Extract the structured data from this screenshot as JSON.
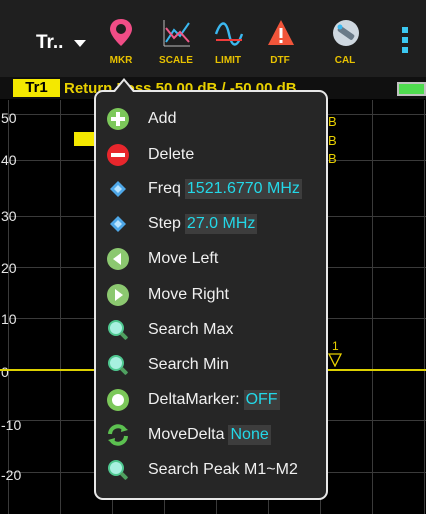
{
  "toolbar": {
    "trace_selector": "Tr..",
    "buttons": [
      {
        "label": "MKR",
        "icon": "marker-pin-icon"
      },
      {
        "label": "SCALE",
        "icon": "scale-icon"
      },
      {
        "label": "LIMIT",
        "icon": "limit-icon"
      },
      {
        "label": "DTF",
        "icon": "dtf-warning-icon"
      },
      {
        "label": "CAL",
        "icon": "cal-icon"
      }
    ],
    "more_icon": "more-vertical-icon"
  },
  "status_strip": {
    "trace_badge": "Tr1",
    "text": "Return Loss 50.00 dB / -50.00 dB"
  },
  "plot": {
    "y_ticks": [
      "50",
      "40",
      "30",
      "20",
      "10",
      "0",
      "-10",
      "-20"
    ],
    "marker_label": "1",
    "behind_menu_fragments": [
      "B",
      "B",
      "B"
    ]
  },
  "menu": {
    "items": [
      {
        "label": "Add",
        "icon": "add-icon"
      },
      {
        "label": "Delete",
        "icon": "delete-icon"
      },
      {
        "label": "Freq",
        "value": "1521.6770 MHz",
        "icon": "diamond-icon"
      },
      {
        "label": "Step",
        "value": "27.0 MHz",
        "icon": "diamond-icon"
      },
      {
        "label": "Move Left",
        "icon": "move-left-icon"
      },
      {
        "label": "Move Right",
        "icon": "move-right-icon"
      },
      {
        "label": "Search Max",
        "icon": "search-max-icon"
      },
      {
        "label": "Search Min",
        "icon": "search-min-icon"
      },
      {
        "label": "DeltaMarker:",
        "value": "OFF",
        "icon": "delta-toggle-icon"
      },
      {
        "label": "MoveDelta",
        "value": "None",
        "icon": "move-delta-icon"
      },
      {
        "label": "Search Peak M1~M2",
        "icon": "search-peak-icon"
      }
    ]
  },
  "colors": {
    "accent_yellow": "#f4e800",
    "value_cyan": "#23d8e8",
    "menu_bg": "#262626"
  }
}
